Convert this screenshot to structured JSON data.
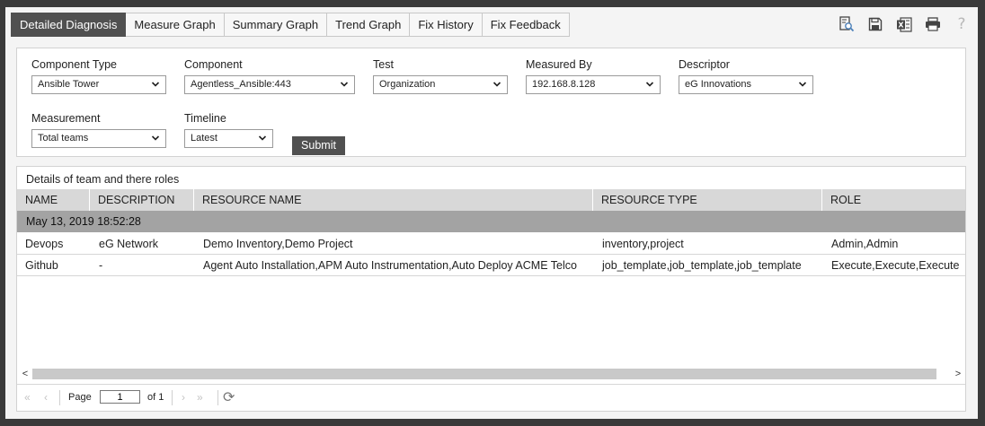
{
  "tabs": [
    {
      "label": "Detailed Diagnosis",
      "active": true
    },
    {
      "label": "Measure Graph"
    },
    {
      "label": "Summary Graph"
    },
    {
      "label": "Trend Graph"
    },
    {
      "label": "Fix History"
    },
    {
      "label": "Fix Feedback"
    }
  ],
  "toolbar": {
    "icons": [
      "search-document-icon",
      "save-icon",
      "excel-export-icon",
      "print-icon",
      "help-icon"
    ],
    "help_glyph": "?"
  },
  "filters": {
    "component_type": {
      "label": "Component Type",
      "value": "Ansible Tower"
    },
    "component": {
      "label": "Component",
      "value": "Agentless_Ansible:443"
    },
    "test": {
      "label": "Test",
      "value": "Organization"
    },
    "measured_by": {
      "label": "Measured By",
      "value": "192.168.8.128"
    },
    "descriptor": {
      "label": "Descriptor",
      "value": "eG Innovations"
    },
    "measurement": {
      "label": "Measurement",
      "value": "Total teams"
    },
    "timeline": {
      "label": "Timeline",
      "value": "Latest"
    },
    "submit_label": "Submit"
  },
  "results": {
    "title": "Details of team and there roles",
    "columns": [
      "NAME",
      "DESCRIPTION",
      "RESOURCE NAME",
      "RESOURCE TYPE",
      "ROLE"
    ],
    "group_label": "May 13, 2019 18:52:28",
    "rows": [
      [
        "Devops",
        "eG Network",
        "Demo Inventory,Demo Project",
        "inventory,project",
        "Admin,Admin"
      ],
      [
        "Github",
        "-",
        "Agent Auto Installation,APM Auto Instrumentation,Auto Deploy ACME Telco",
        "job_template,job_template,job_template",
        "Execute,Execute,Execute"
      ]
    ]
  },
  "scroll": {
    "left_arrow": "<",
    "right_arrow": ">"
  },
  "pager": {
    "first": "«",
    "prev": "‹",
    "next": "›",
    "last": "»",
    "page_label": "Page",
    "page_value": "1",
    "of_label": "of 1",
    "refresh": "⟳"
  }
}
